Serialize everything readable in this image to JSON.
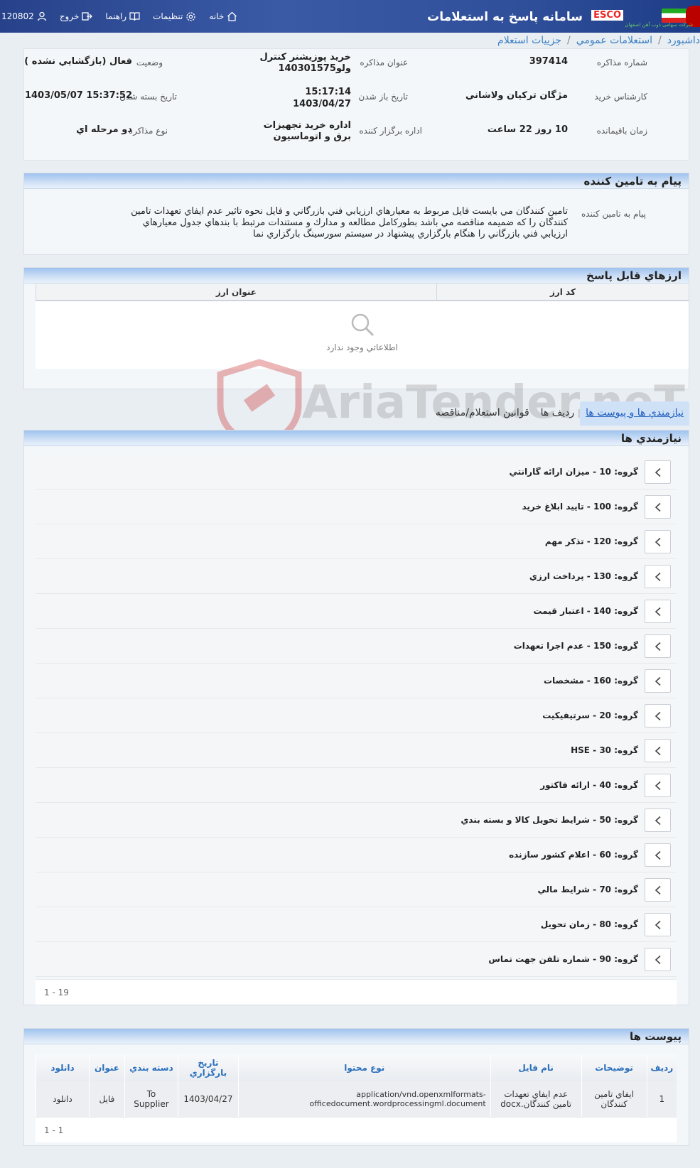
{
  "header": {
    "title": "سامانه پاسخ به استعلامات",
    "esco": "ESCO",
    "company_line": "شرکت سهامی ذوب آهن اصفهان",
    "user_id": "120802",
    "nav": {
      "logout": "خروج",
      "help": "راهنما",
      "settings": "تنظیمات",
      "home": "خانه"
    }
  },
  "breadcrumb": [
    "داشبورد",
    "استعلامات عمومي",
    "جزييات استعلام"
  ],
  "inquiry": {
    "number_label": "شماره مذاكره",
    "number": "397414",
    "title_label": "عنوان مذاكره",
    "title": "خريد پوزيشنر كنترل ولو140301575",
    "status_label": "وضعيت",
    "status": "فعال (بازگشايي نشده )",
    "expert_label": "كارشناس خريد",
    "expert": "مژگان تركيان ولاشاني",
    "open_label": "تاريخ باز شدن",
    "open_time": "15:17:14",
    "open_date": "1403/04/27",
    "close_label": "تاريخ بسته شدن",
    "close": "1403/05/07 15:37:52",
    "remaining_label": "زمان باقيمانده",
    "remaining": "10 روز 22 ساعت",
    "org_label": "اداره برگزار كننده",
    "org": "اداره خريد تجهيزات برق و اتوماسيون",
    "type_label": "نوع مذاكره",
    "type": "دو مرحله اي"
  },
  "supplier_message": {
    "panel_title": "پيام به تامين كننده",
    "label": "پيام به تامين كننده",
    "text": "تامين كنندگان مي بايست فايل مربوط به معيارهاي ارزيابي فني بازرگاني و فايل نحوه تاثير عدم ايفاي تعهدات تامين كنندگان را كه ضميمه مناقصه مي باشد بطوركامل مطالعه و مدارك و مستندات مرتبط با بندهاي جدول معيارهاي ارزيابي فني بازرگاني را هنگام بارگزاري پيشنهاد در سيستم سورسينگ بارگزاري نما"
  },
  "currencies": {
    "panel_title": "ارزهاي قابل پاسخ",
    "columns": [
      "كد ارز",
      "عنوان ارز"
    ],
    "empty_text": "اطلاعاتي وجود ندارد"
  },
  "tabs": [
    "نيازمندي ها و پيوست ها",
    "رديف ها",
    "قوانين استعلام/مناقصه"
  ],
  "requirements": {
    "panel_title": "نيازمندي ها",
    "groups": [
      "گروه: 10 - ميزان ارائه گارانتي",
      "گروه: 100 - تاييد ابلاغ خريد",
      "گروه: 120 - تذكر مهم",
      "گروه: 130 - پرداخت ارزي",
      "گروه: 140 - اعتبار قيمت",
      "گروه: 150 - عدم اجرا تعهدات",
      "گروه: 160 - مشخصات",
      "گروه: 20 - سرتيفيكيت",
      "گروه: 30 - HSE",
      "گروه: 40 - ارائه فاكتور",
      "گروه: 50 - شرايط تحويل كالا و بسته بندي",
      "گروه: 60 - اعلام كشور سازنده",
      "گروه: 70 - شرايط مالي",
      "گروه: 80 - زمان تحويل",
      "گروه: 90 - شماره تلفن جهت تماس"
    ],
    "pager": "1 - 19"
  },
  "attachments": {
    "panel_title": "پيوست ها",
    "columns": [
      "رديف",
      "توضيحات",
      "نام فايل",
      "نوع محتوا",
      "تاريخ بارگزاري",
      "دسته بندي",
      "عنوان",
      "دانلود"
    ],
    "rows": [
      {
        "row": "1",
        "desc": "ايفاي تامين كنندگان",
        "filename": "عدم ايفاي تعهدات تامين كنندگان.docx",
        "content_type": "application/vnd.openxmlformats-officedocument.wordprocessingml.document",
        "date": "1403/04/27",
        "category": "To Supplier",
        "title": "فايل",
        "download": "دانلود"
      }
    ],
    "pager": "1 - 1"
  },
  "watermark": "AriaTender.neT",
  "colors": {
    "header_bg": "#2f4f9a",
    "accent_blue": "#2a6fbb",
    "panel_head": "#9ec2ee"
  }
}
